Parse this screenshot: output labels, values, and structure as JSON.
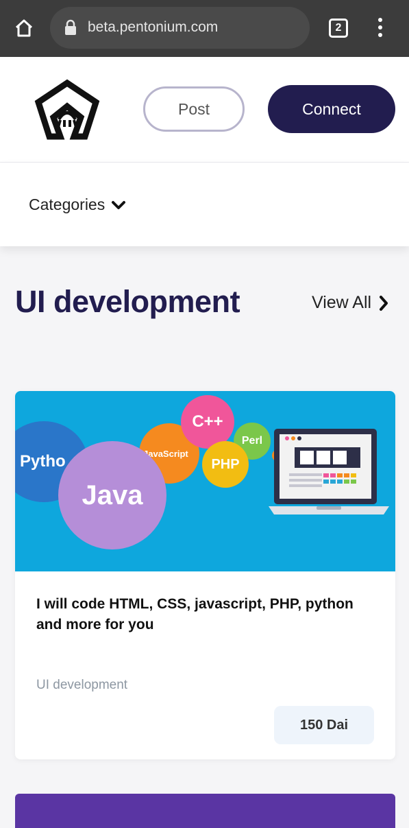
{
  "browser": {
    "url": "beta.pentonium.com",
    "tab_count": "2"
  },
  "header": {
    "post_label": "Post",
    "connect_label": "Connect"
  },
  "nav": {
    "categories_label": "Categories"
  },
  "section": {
    "title": "UI development",
    "view_all_label": "View All"
  },
  "card": {
    "image_languages": {
      "python": "Pytho",
      "java": "Java",
      "javascript": "JavaScript",
      "cpp": "C++",
      "php": "PHP",
      "perl": "Perl"
    },
    "title": "I will code HTML, CSS, javascript, PHP, python and more for you",
    "category": "UI development",
    "price": "150 Dai"
  },
  "colors": {
    "brand_dark": "#221d4f",
    "chrome_bg": "#3c3c3c",
    "card_image_bg": "#0ea7dd",
    "next_card_bg": "#5a35a3"
  }
}
